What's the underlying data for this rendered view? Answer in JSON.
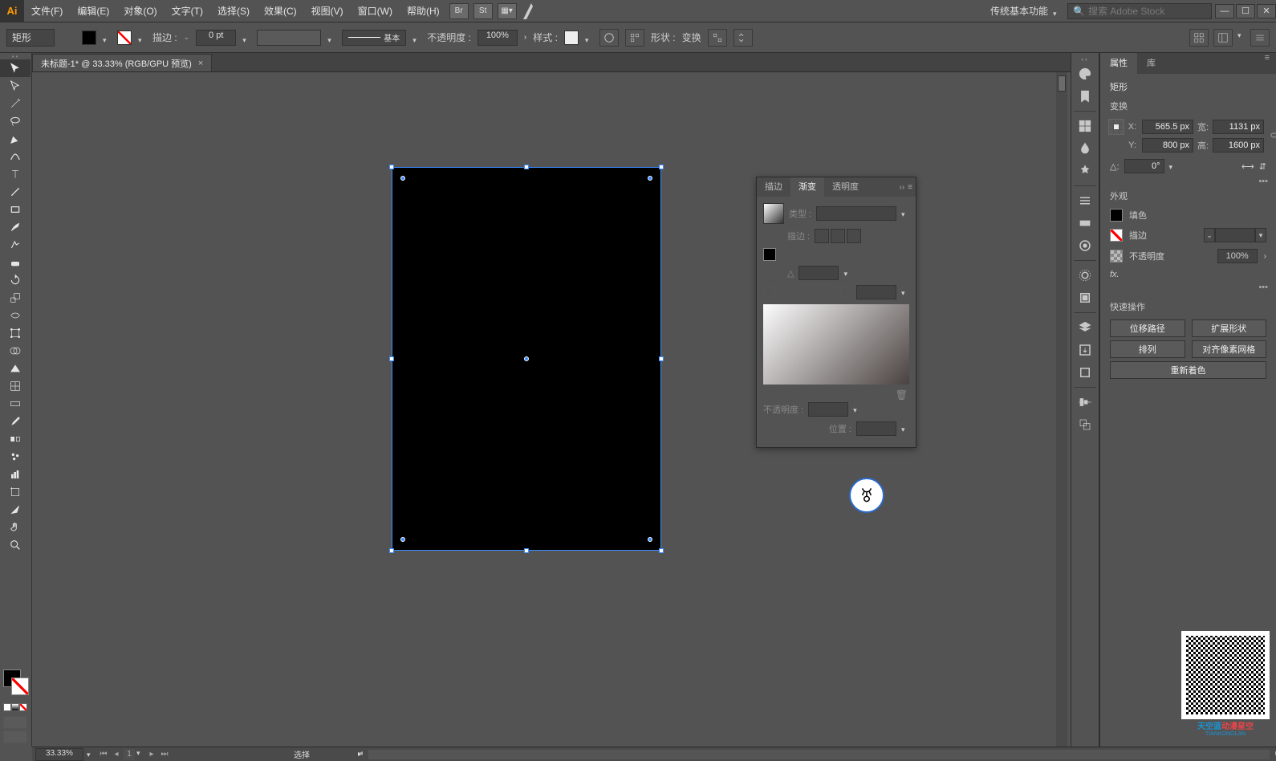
{
  "app": {
    "logo": "Ai"
  },
  "menu": {
    "items": [
      "文件(F)",
      "编辑(E)",
      "对象(O)",
      "文字(T)",
      "选择(S)",
      "效果(C)",
      "视图(V)",
      "窗口(W)",
      "帮助(H)"
    ],
    "quick_icons": [
      "Br",
      "St"
    ],
    "workspace": "传统基本功能",
    "search_placeholder": "搜索 Adobe Stock"
  },
  "controlbar": {
    "shape_label": "矩形",
    "stroke_label": "描边 :",
    "stroke_width": "0 pt",
    "stroke_style_label": "基本",
    "opacity_label": "不透明度 :",
    "opacity_value": "100%",
    "style_label": "样式 :",
    "shape_btn": "形状 :",
    "transform_btn": "变换"
  },
  "doc_tab": {
    "title": "未标题-1* @ 33.33% (RGB/GPU 预览)"
  },
  "gradient_panel": {
    "tabs": [
      "描边",
      "渐变",
      "透明度"
    ],
    "active_tab_index": 1,
    "type_label": "类型 :",
    "stroke_label": "描边 :",
    "angle_label": "△",
    "opacity_label": "不透明度 :",
    "position_label": "位置 :"
  },
  "dock_icons": [
    "palette",
    "page",
    "swatches",
    "brushes",
    "symbols",
    "menu1",
    "rect",
    "ring",
    "transparency",
    "menu2",
    "layers",
    "export",
    "artboards",
    "menu3",
    "align",
    "pathfinder"
  ],
  "properties": {
    "tabs": [
      "属性",
      "库"
    ],
    "active_tab_index": 0,
    "obj_type": "矩形",
    "transform_title": "变换",
    "x_label": "X:",
    "x_val": "565.5 px",
    "y_label": "Y:",
    "y_val": "800 px",
    "w_label": "宽:",
    "w_val": "1131 px",
    "h_label": "高:",
    "h_val": "1600 px",
    "angle_label": "△:",
    "angle_val": "0°",
    "appearance_title": "外观",
    "fill_label": "填色",
    "stroke_label": "描边",
    "opacity_label": "不透明度",
    "opacity_val": "100%",
    "fx_label": "fx.",
    "quick_title": "快速操作",
    "btn_offset": "位移路径",
    "btn_expand": "扩展形状",
    "btn_arrange": "排列",
    "btn_pixel": "对齐像素网格",
    "btn_recolor": "重新着色"
  },
  "status": {
    "zoom": "33.33%",
    "page": "1",
    "mode": "选择"
  },
  "overlay": {
    "brand1": "天空蓝",
    "brand2": "动漫星空",
    "brand3": "TIANKONGLAN"
  }
}
